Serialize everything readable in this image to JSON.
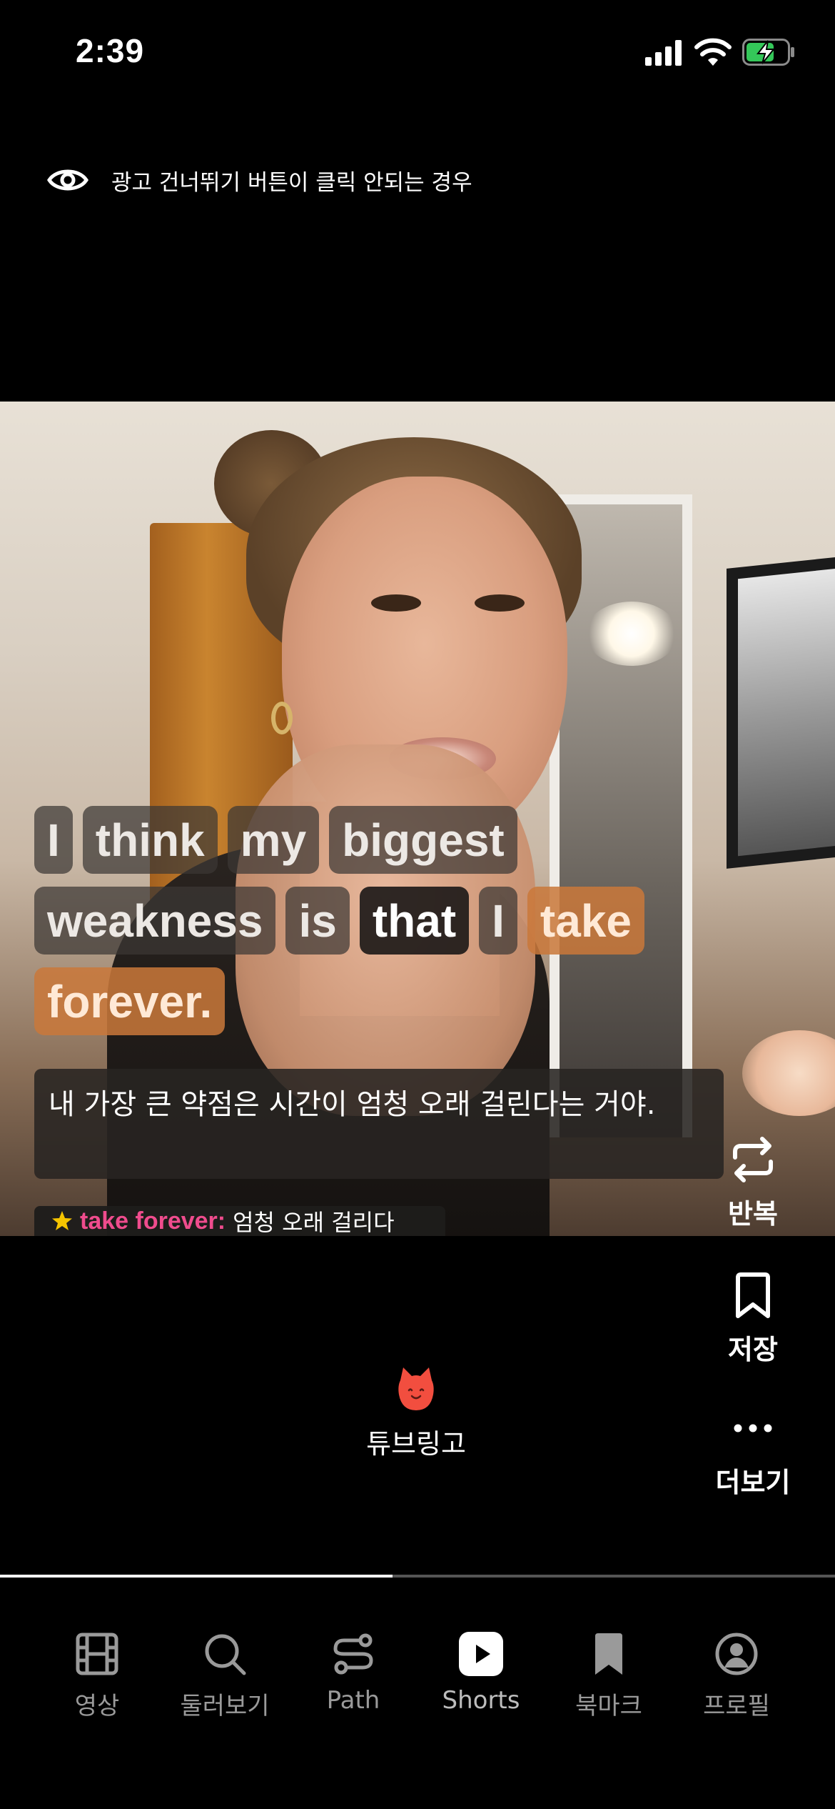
{
  "status_bar": {
    "time": "2:39"
  },
  "ad_hint": {
    "text": "광고 건너뛰기 버튼이 클릭 안되는 경우",
    "icon": "eye-icon"
  },
  "subtitle_en": {
    "lines": [
      [
        "I",
        "think",
        "my",
        "biggest"
      ],
      [
        "weakness",
        "is",
        "that",
        "I",
        "take"
      ],
      [
        "forever."
      ]
    ],
    "active_word": "that",
    "highlighted_phrase": "take forever."
  },
  "subtitle_ko": "내 가장 큰 약점은 시간이 엄청 오래 걸린다는 거야.",
  "vocab": {
    "term": "take forever:",
    "definition": "엄청 오래 걸리다",
    "icon": "star-icon"
  },
  "actions": {
    "repeat": "반복",
    "save": "저장",
    "more": "더보기"
  },
  "brand": {
    "name": "튜브링고"
  },
  "progress": {
    "fraction": 0.47
  },
  "tabs": [
    {
      "label": "영상",
      "icon": "film-icon"
    },
    {
      "label": "둘러보기",
      "icon": "search-icon"
    },
    {
      "label": "Path",
      "icon": "path-icon"
    },
    {
      "label": "Shorts",
      "icon": "play-icon",
      "active": true
    },
    {
      "label": "북마크",
      "icon": "bookmark-icon"
    },
    {
      "label": "프로필",
      "icon": "profile-icon"
    }
  ],
  "colors": {
    "highlight": "#c9783a",
    "vocab_term": "#ef4c8d",
    "star": "#f5c400",
    "battery": "#34c759",
    "mascot": "#f24e3f"
  }
}
